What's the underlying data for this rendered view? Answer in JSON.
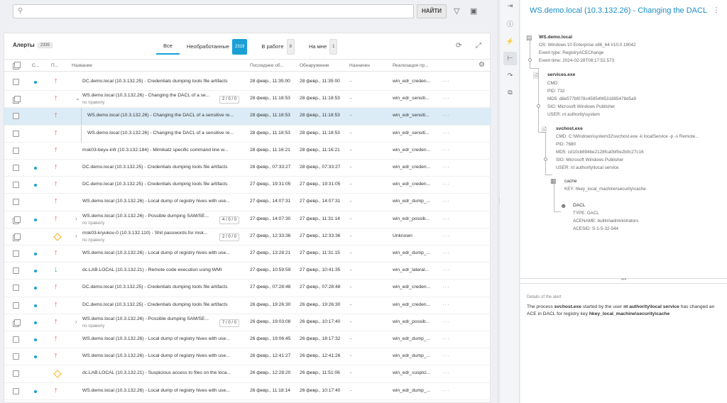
{
  "search": {
    "placeholder": "",
    "button": "НАЙТИ"
  },
  "alerts": {
    "title": "Алерты",
    "total": "2335",
    "tabs": [
      {
        "label": "Все",
        "badge": ""
      },
      {
        "label": "Необработанные",
        "badge": "2319"
      },
      {
        "label": "В работе",
        "badge": "8"
      },
      {
        "label": "На мне",
        "badge": "1"
      }
    ],
    "columns": [
      "С...",
      "П...",
      "Название",
      "Последнее об...",
      "Обнаружение",
      "Назначен",
      "Реализация пр..."
    ],
    "rows": [
      {
        "name": "DC.demo.local (10.3.132.25) - Credentials dumping tools file artifacts",
        "last": "28 февр., 11:35:00",
        "detect": "28 февр., 11:35:00",
        "assignee": "-",
        "impl": "win_edr_creden...",
        "dot": true,
        "sev": "red",
        "multi": false,
        "expand": false,
        "sub": "",
        "count": ""
      },
      {
        "name": "WS.demo.local (10.3.132.26) - Changing the DACL of a se...",
        "last": "28 февр., 11:18:53",
        "detect": "28 февр., 11:18:53",
        "assignee": "-",
        "impl": "win_edr_sensiti...",
        "dot": false,
        "sev": "red",
        "multi": true,
        "expand": "open",
        "sub": "по правилу",
        "count": "2 / 0 / 0"
      },
      {
        "name": "WS.demo.local (10.3.132.26) - Changing the DACL of a sensitive re...",
        "last": "28 февр., 11:18:53",
        "detect": "28 февр., 11:18:53",
        "assignee": "-",
        "impl": "win_edr_sensiti...",
        "dot": false,
        "sev": "red",
        "multi": false,
        "expand": false,
        "sub": "",
        "count": "",
        "child": true,
        "selected": true
      },
      {
        "name": "WS.demo.local (10.3.132.26) - Changing the DACL of a sensitive re...",
        "last": "28 февр., 11:18:53",
        "detect": "28 февр., 11:18:53",
        "assignee": "-",
        "impl": "win_edr_sensiti...",
        "dot": false,
        "sev": "red",
        "multi": false,
        "expand": false,
        "sub": "",
        "count": "",
        "child": true
      },
      {
        "name": "msk03-beyu-infr (10.3.132.184) - Mimikatz specific command line w...",
        "last": "28 февр., 11:16:21",
        "detect": "28 февр., 11:16:21",
        "assignee": "-",
        "impl": "win_edr_creden...",
        "dot": false,
        "sev": "red",
        "multi": false,
        "expand": false,
        "sub": "",
        "count": ""
      },
      {
        "name": "DC.demo.local (10.3.132.25) - Credentials dumping tools file artifacts",
        "last": "28 февр., 07:33:27",
        "detect": "28 февр., 07:33:27",
        "assignee": "-",
        "impl": "win_edr_creden...",
        "dot": true,
        "sev": "red",
        "multi": false,
        "expand": false,
        "sub": "",
        "count": ""
      },
      {
        "name": "DC.demo.local (10.3.132.25) - Credentials dumping tools file artifacts",
        "last": "27 февр., 19:31:05",
        "detect": "27 февр., 19:31:05",
        "assignee": "-",
        "impl": "win_edr_creden...",
        "dot": true,
        "sev": "red",
        "multi": false,
        "expand": false,
        "sub": "",
        "count": ""
      },
      {
        "name": "WS.demo.local (10.3.132.26) - Local dump of registry hives with use...",
        "last": "27 февр., 14:07:31",
        "detect": "27 февр., 14:07:31",
        "assignee": "-",
        "impl": "win_edr_dump_...",
        "dot": false,
        "sev": "red",
        "multi": false,
        "expand": false,
        "sub": "",
        "count": ""
      },
      {
        "name": "WS.demo.local (10.3.132.26) - Possible dumping SAM/SE...",
        "last": "27 февр., 14:07:30",
        "detect": "27 февр., 11:31:14",
        "assignee": "-",
        "impl": "win_edr_possib...",
        "dot": true,
        "sev": "red",
        "multi": true,
        "expand": "closed",
        "sub": "по правилу",
        "count": "4 / 0 / 0"
      },
      {
        "name": "msk03-kryukov-0 (10.3.132.110) - Shit passwords for msk...",
        "last": "27 февр., 12:33:36",
        "detect": "27 февр., 12:33:36",
        "assignee": "-",
        "impl": "Unknown",
        "dot": false,
        "sev": "yellow",
        "multi": true,
        "expand": "closed",
        "sub": "по правилу",
        "count": "2 / 0 / 0"
      },
      {
        "name": "WS.demo.local (10.3.132.26) - Local dump of registry hives with use...",
        "last": "27 февр., 13:28:21",
        "detect": "27 февр., 11:31:15",
        "assignee": "-",
        "impl": "win_edr_dump_...",
        "dot": true,
        "sev": "red",
        "multi": false,
        "expand": false,
        "sub": "",
        "count": ""
      },
      {
        "name": "dc.LAB.LOCAL (10.3.132.21) - Remote code execution using WMI",
        "last": "27 февр., 10:59:59",
        "detect": "27 февр., 10:41:35",
        "assignee": "-",
        "impl": "win_edr_lateral...",
        "dot": true,
        "sev": "green",
        "multi": false,
        "expand": false,
        "sub": "",
        "count": ""
      },
      {
        "name": "DC.demo.local (10.3.132.25) - Credentials dumping tools file artifacts",
        "last": "27 февр., 07:28:48",
        "detect": "27 февр., 07:28:48",
        "assignee": "-",
        "impl": "win_edr_creden...",
        "dot": true,
        "sev": "red",
        "multi": false,
        "expand": false,
        "sub": "",
        "count": ""
      },
      {
        "name": "DC.demo.local (10.3.132.25) - Credentials dumping tools file artifacts",
        "last": "26 февр., 19:26:30",
        "detect": "26 февр., 19:26:30",
        "assignee": "-",
        "impl": "win_edr_creden...",
        "dot": true,
        "sev": "red",
        "multi": false,
        "expand": false,
        "sub": "",
        "count": ""
      },
      {
        "name": "WS.demo.local (10.3.132.26) - Possible dumping SAM/SE...",
        "last": "26 февр., 19:03:08",
        "detect": "26 февр., 10:17:40",
        "assignee": "-",
        "impl": "win_edr_possib...",
        "dot": true,
        "sev": "red",
        "multi": true,
        "expand": "closed",
        "sub": "по правилу",
        "count": "7 / 0 / 0"
      },
      {
        "name": "WS.demo.local (10.3.132.26) - Local dump of registry hives with use...",
        "last": "26 февр., 19:06:45",
        "detect": "26 февр., 18:17:32",
        "assignee": "-",
        "impl": "win_edr_dump_...",
        "dot": true,
        "sev": "red",
        "multi": false,
        "expand": false,
        "sub": "",
        "count": ""
      },
      {
        "name": "WS.demo.local (10.3.132.26) - Local dump of registry hives with use...",
        "last": "26 февр., 12:41:27",
        "detect": "26 февр., 12:41:26",
        "assignee": "-",
        "impl": "win_edr_dump_...",
        "dot": true,
        "sev": "red",
        "multi": false,
        "expand": false,
        "sub": "",
        "count": ""
      },
      {
        "name": "dc.LAB.LOCAL (10.3.132.21) - Suspicious access to files on the loca...",
        "last": "26 февр., 12:28:20",
        "detect": "26 февр., 11:51:06",
        "assignee": "-",
        "impl": "win_edr_suspici...",
        "dot": false,
        "sev": "yellow",
        "multi": false,
        "expand": false,
        "sub": "",
        "count": ""
      },
      {
        "name": "WS.demo.local (10.3.132.26) - Local dump of registry hives with use...",
        "last": "26 февр., 11:18:14",
        "detect": "26 февр., 10:17:40",
        "assignee": "-",
        "impl": "win_edr_dump_...",
        "dot": true,
        "sev": "red",
        "multi": false,
        "expand": false,
        "sub": "",
        "count": ""
      }
    ],
    "row_menu": "···"
  },
  "detail": {
    "title": "WS.demo.local (10.3.132.26) - Changing the DACL o",
    "host": {
      "name": "WS.demo.local",
      "os": "OS: Windows 10 Enterprise x86_64 #10.0.19042",
      "event_type": "Event type: RegistryACEChange",
      "event_time": "Event time: 2024-02-28T08:17:52.573"
    },
    "services": {
      "name": "services.exe",
      "cmd": "CMD:",
      "pid": "PID: 732",
      "md5": "MD5: d8e577bf078c45954f4531885478d5a9",
      "sig": "SIG: Microsoft Windows Publisher",
      "user": "USER: nt authority\\system"
    },
    "svchost": {
      "name": "svchost.exe",
      "cmd": "CMD: C:\\Windows\\system32\\svchost.exe -k localService -p -s Remote...",
      "pid": "PID: 7680",
      "md5": "MD5: cd10cb894be2128fca0bf0e2b0c27c16",
      "sig": "SIG: Microsoft Windows Publisher",
      "user": "USER: nt authority\\local service"
    },
    "cache": {
      "name": "cache",
      "key": "KEY: hkey_local_machine\\security\\cache"
    },
    "dacl": {
      "name": "DACL",
      "type": "TYPE: DACL",
      "acename": "ACENAME: builtin\\administrators",
      "acesid": "ACESID: S-1-5-32-544"
    },
    "details_heading": "Details of the alert",
    "details_parts": {
      "p1": "The process ",
      "proc": "svchost.exe",
      "p2": " started by the user ",
      "user": "nt authority\\local service",
      "p3": " has changed an ACE in DACL for registry key ",
      "key": "hkey_local_machine\\security\\cache"
    }
  },
  "icons": {
    "search": "search-icon",
    "filter": "filter-icon",
    "save": "save-icon",
    "refresh": "refresh-icon",
    "expand": "fullscreen-icon",
    "settings": "gear-icon"
  },
  "colors": {
    "accent": "#1aa0d6",
    "severity_high": "#e05a4a",
    "severity_low": "#3aa74a",
    "severity_medium": "#f0b020"
  }
}
